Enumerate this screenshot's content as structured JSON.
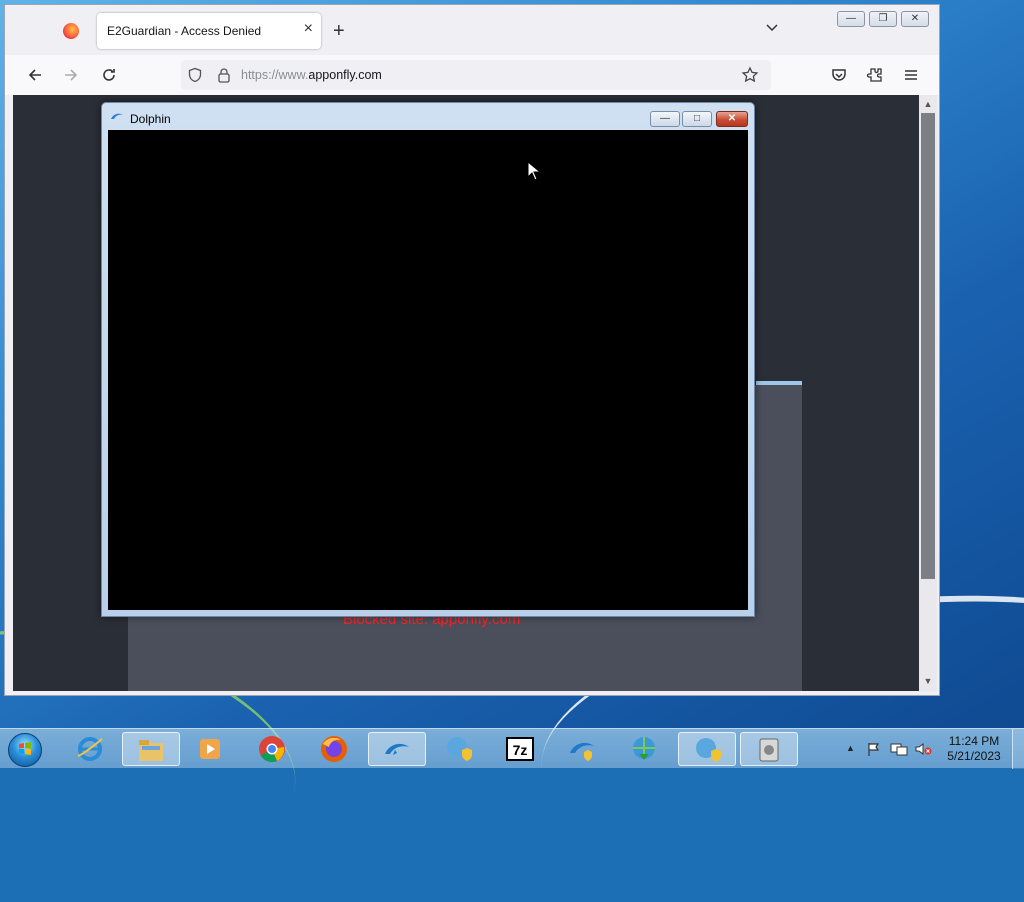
{
  "firefox": {
    "tab_title": "E2Guardian - Access Denied",
    "tab_close": "×",
    "new_tab": "+",
    "url_prefix": "https://www.",
    "url_domain": "apponfly.com",
    "icons": [
      "firefox-logo-icon",
      "back-icon",
      "forward-icon",
      "reload-icon",
      "shield-icon",
      "lock-icon",
      "bookmark-star-icon",
      "pocket-icon",
      "extensions-icon",
      "menu-icon",
      "list-all-tabs-icon"
    ]
  },
  "page": {
    "error_text": "Blocked site: apponfly.com"
  },
  "dolphin": {
    "title": "Dolphin"
  },
  "taskbar": {
    "apps": [
      "internet-explorer",
      "windows-explorer",
      "media-player",
      "chrome",
      "firefox",
      "dolphin",
      "network-security",
      "7zip",
      "dolphin-2",
      "download-manager",
      "network-security-2",
      "disk-utility"
    ],
    "clock_time": "11:24 PM",
    "clock_date": "5/21/2023"
  },
  "colors": {
    "desktop_blue": "#2f86cf",
    "error_red": "#ff2020",
    "dolphin_close_red": "#c94d33"
  }
}
